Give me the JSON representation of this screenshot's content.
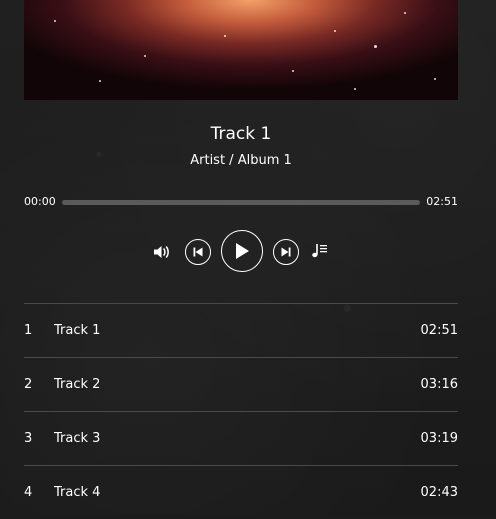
{
  "player": {
    "title": "Track 1",
    "subtitle": "Artist / Album 1",
    "elapsed": "00:00",
    "duration": "02:51",
    "progress": 0
  },
  "controls": {
    "volume_icon": "volume-icon",
    "prev_icon": "skip-previous-icon",
    "play_icon": "play-icon",
    "next_icon": "skip-next-icon",
    "playlist_icon": "playlist-icon"
  },
  "tracks": [
    {
      "num": "1",
      "name": "Track 1",
      "dur": "02:51"
    },
    {
      "num": "2",
      "name": "Track 2",
      "dur": "03:16"
    },
    {
      "num": "3",
      "name": "Track 3",
      "dur": "03:19"
    },
    {
      "num": "4",
      "name": "Track 4",
      "dur": "02:43"
    }
  ]
}
